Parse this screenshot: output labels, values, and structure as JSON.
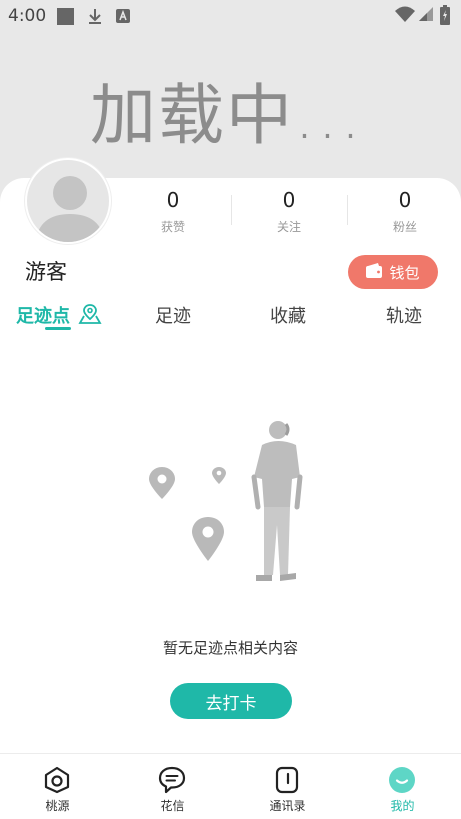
{
  "status_bar": {
    "time": "4:00"
  },
  "banner": {
    "loading_text": "加载中..."
  },
  "profile": {
    "username": "游客",
    "stats": [
      {
        "value": "0",
        "label": "获赞"
      },
      {
        "value": "0",
        "label": "关注"
      },
      {
        "value": "0",
        "label": "粉丝"
      }
    ],
    "wallet_label": "钱包"
  },
  "tabs": [
    {
      "label": "足迹点",
      "active": true
    },
    {
      "label": "足迹",
      "active": false
    },
    {
      "label": "收藏",
      "active": false
    },
    {
      "label": "轨迹",
      "active": false
    }
  ],
  "empty_state": {
    "message": "暂无足迹点相关内容",
    "button_label": "去打卡"
  },
  "bottom_nav": [
    {
      "label": "桃源",
      "icon": "camera-icon",
      "active": false
    },
    {
      "label": "花信",
      "icon": "chat-icon",
      "active": false
    },
    {
      "label": "通讯录",
      "icon": "contacts-icon",
      "active": false
    },
    {
      "label": "我的",
      "icon": "smile-icon",
      "active": true
    }
  ],
  "colors": {
    "accent": "#1fb8a8",
    "wallet": "#f0786a",
    "banner_bg": "#e8e8e8"
  }
}
